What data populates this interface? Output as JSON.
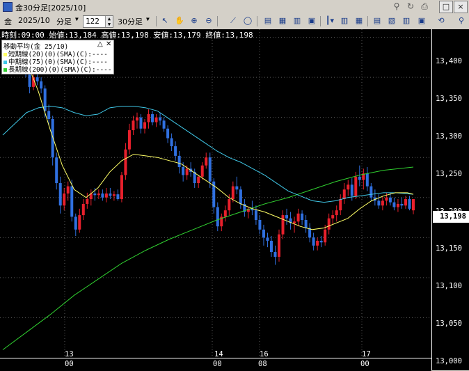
{
  "window": {
    "title": "金30分足[2025/10]",
    "buttons": [
      "□",
      "×"
    ]
  },
  "toolbar": {
    "symbol": "金",
    "contract": "2025/10",
    "bar_type": "分足",
    "count": "122",
    "interval": "30分足"
  },
  "info_bar": "時刻:09:00 始値:13,184 高値:13,198 安値:13,179 終値:13,198",
  "indicator_legend": {
    "title": "移動平均(金 25/10)",
    "lines": [
      {
        "label": "短期線(20)(0)(SMA)(C):----",
        "color": "#ffff66"
      },
      {
        "label": "中期線(75)(0)(SMA)(C):----",
        "color": "#40c8e8"
      },
      {
        "label": "長期線(200)(0)(SMA)(C):----",
        "color": "#30d030"
      }
    ]
  },
  "price_axis": {
    "labels": [
      "13,400",
      "13,350",
      "13,300",
      "13,250",
      "13,200",
      "13,150",
      "13,100",
      "13,050",
      "13,000"
    ],
    "current_price": "13,198"
  },
  "time_axis": {
    "day_labels": [
      "13",
      "14",
      "16",
      "17"
    ],
    "hour_labels": [
      "00",
      "00",
      "08",
      "00"
    ]
  },
  "chart_data": {
    "type": "candlestick",
    "ylim": [
      13000,
      13410
    ],
    "up_color": "#e8202c",
    "down_color": "#3070e0",
    "candles": [
      [
        13390,
        13395,
        13370,
        13382
      ],
      [
        13382,
        13392,
        13372,
        13388
      ],
      [
        13388,
        13398,
        13380,
        13385
      ],
      [
        13385,
        13390,
        13374,
        13378
      ],
      [
        13378,
        13386,
        13366,
        13382
      ],
      [
        13382,
        13384,
        13360,
        13366
      ],
      [
        13366,
        13372,
        13350,
        13356
      ],
      [
        13356,
        13360,
        13330,
        13338
      ],
      [
        13338,
        13356,
        13334,
        13350
      ],
      [
        13350,
        13356,
        13340,
        13345
      ],
      [
        13345,
        13350,
        13330,
        13336
      ],
      [
        13336,
        13340,
        13300,
        13308
      ],
      [
        13308,
        13316,
        13290,
        13298
      ],
      [
        13298,
        13302,
        13240,
        13250
      ],
      [
        13250,
        13256,
        13210,
        13218
      ],
      [
        13218,
        13226,
        13180,
        13190
      ],
      [
        13190,
        13212,
        13184,
        13205
      ],
      [
        13205,
        13220,
        13196,
        13214
      ],
      [
        13214,
        13222,
        13170,
        13176
      ],
      [
        13176,
        13180,
        13152,
        13160
      ],
      [
        13160,
        13186,
        13156,
        13178
      ],
      [
        13178,
        13198,
        13172,
        13192
      ],
      [
        13192,
        13206,
        13186,
        13198
      ],
      [
        13198,
        13210,
        13190,
        13205
      ],
      [
        13205,
        13212,
        13196,
        13203
      ],
      [
        13203,
        13210,
        13198,
        13205
      ],
      [
        13205,
        13210,
        13196,
        13200
      ],
      [
        13200,
        13212,
        13194,
        13205
      ],
      [
        13205,
        13212,
        13198,
        13202
      ],
      [
        13202,
        13208,
        13196,
        13204
      ],
      [
        13204,
        13210,
        13196,
        13198
      ],
      [
        13198,
        13232,
        13194,
        13228
      ],
      [
        13228,
        13268,
        13222,
        13260
      ],
      [
        13260,
        13292,
        13254,
        13284
      ],
      [
        13284,
        13302,
        13278,
        13296
      ],
      [
        13296,
        13306,
        13286,
        13300
      ],
      [
        13300,
        13304,
        13280,
        13286
      ],
      [
        13286,
        13298,
        13280,
        13294
      ],
      [
        13294,
        13310,
        13286,
        13304
      ],
      [
        13304,
        13308,
        13290,
        13294
      ],
      [
        13294,
        13304,
        13288,
        13300
      ],
      [
        13300,
        13306,
        13290,
        13296
      ],
      [
        13296,
        13300,
        13282,
        13286
      ],
      [
        13286,
        13290,
        13268,
        13274
      ],
      [
        13274,
        13280,
        13258,
        13264
      ],
      [
        13264,
        13270,
        13246,
        13252
      ],
      [
        13252,
        13258,
        13230,
        13238
      ],
      [
        13238,
        13244,
        13220,
        13228
      ],
      [
        13228,
        13240,
        13222,
        13236
      ],
      [
        13236,
        13244,
        13226,
        13232
      ],
      [
        13232,
        13236,
        13212,
        13218
      ],
      [
        13218,
        13228,
        13212,
        13226
      ],
      [
        13226,
        13244,
        13222,
        13240
      ],
      [
        13240,
        13256,
        13236,
        13250
      ],
      [
        13250,
        13256,
        13212,
        13220
      ],
      [
        13220,
        13224,
        13180,
        13188
      ],
      [
        13188,
        13194,
        13158,
        13164
      ],
      [
        13164,
        13180,
        13158,
        13176
      ],
      [
        13176,
        13190,
        13170,
        13184
      ],
      [
        13184,
        13204,
        13178,
        13198
      ],
      [
        13198,
        13220,
        13194,
        13214
      ],
      [
        13214,
        13226,
        13204,
        13210
      ],
      [
        13210,
        13214,
        13186,
        13192
      ],
      [
        13192,
        13198,
        13176,
        13182
      ],
      [
        13182,
        13188,
        13174,
        13186
      ],
      [
        13186,
        13196,
        13178,
        13184
      ],
      [
        13184,
        13190,
        13166,
        13172
      ],
      [
        13172,
        13178,
        13154,
        13160
      ],
      [
        13160,
        13166,
        13140,
        13150
      ],
      [
        13150,
        13156,
        13138,
        13146
      ],
      [
        13146,
        13152,
        13126,
        13132
      ],
      [
        13132,
        13140,
        13116,
        13126
      ],
      [
        13126,
        13160,
        13120,
        13154
      ],
      [
        13154,
        13184,
        13148,
        13178
      ],
      [
        13178,
        13186,
        13166,
        13174
      ],
      [
        13174,
        13182,
        13160,
        13168
      ],
      [
        13168,
        13176,
        13156,
        13170
      ],
      [
        13170,
        13186,
        13164,
        13180
      ],
      [
        13180,
        13184,
        13166,
        13172
      ],
      [
        13172,
        13178,
        13156,
        13162
      ],
      [
        13162,
        13168,
        13144,
        13150
      ],
      [
        13150,
        13156,
        13134,
        13140
      ],
      [
        13140,
        13150,
        13134,
        13146
      ],
      [
        13146,
        13152,
        13138,
        13144
      ],
      [
        13144,
        13166,
        13140,
        13160
      ],
      [
        13160,
        13180,
        13154,
        13174
      ],
      [
        13174,
        13184,
        13166,
        13178
      ],
      [
        13178,
        13190,
        13170,
        13184
      ],
      [
        13184,
        13204,
        13178,
        13198
      ],
      [
        13198,
        13218,
        13192,
        13210
      ],
      [
        13210,
        13222,
        13202,
        13216
      ],
      [
        13216,
        13224,
        13196,
        13202
      ],
      [
        13202,
        13232,
        13198,
        13226
      ],
      [
        13226,
        13240,
        13214,
        13222
      ],
      [
        13222,
        13236,
        13210,
        13230
      ],
      [
        13230,
        13238,
        13208,
        13214
      ],
      [
        13214,
        13218,
        13196,
        13200
      ],
      [
        13200,
        13210,
        13190,
        13196
      ],
      [
        13196,
        13204,
        13186,
        13190
      ],
      [
        13190,
        13202,
        13184,
        13196
      ],
      [
        13196,
        13206,
        13190,
        13200
      ],
      [
        13200,
        13206,
        13190,
        13194
      ],
      [
        13194,
        13200,
        13184,
        13188
      ],
      [
        13188,
        13198,
        13182,
        13192
      ],
      [
        13192,
        13200,
        13186,
        13190
      ],
      [
        13190,
        13202,
        13186,
        13198
      ],
      [
        13198,
        13202,
        13184,
        13186
      ],
      [
        13184,
        13198,
        13179,
        13198
      ]
    ],
    "sma20": [
      [
        0,
        13376
      ],
      [
        10,
        13382
      ],
      [
        20,
        13370
      ],
      [
        30,
        13332
      ],
      [
        40,
        13284
      ],
      [
        50,
        13240
      ],
      [
        60,
        13210
      ],
      [
        70,
        13200
      ],
      [
        80,
        13212
      ],
      [
        90,
        13232
      ],
      [
        100,
        13246
      ],
      [
        110,
        13254
      ],
      [
        120,
        13252
      ],
      [
        130,
        13250
      ],
      [
        140,
        13246
      ],
      [
        150,
        13242
      ],
      [
        160,
        13232
      ],
      [
        170,
        13222
      ],
      [
        180,
        13212
      ],
      [
        190,
        13200
      ],
      [
        200,
        13192
      ],
      [
        210,
        13186
      ],
      [
        220,
        13182
      ],
      [
        230,
        13176
      ],
      [
        240,
        13170
      ],
      [
        250,
        13164
      ],
      [
        260,
        13160
      ],
      [
        270,
        13162
      ],
      [
        280,
        13168
      ],
      [
        290,
        13174
      ],
      [
        300,
        13186
      ],
      [
        310,
        13196
      ],
      [
        320,
        13202
      ],
      [
        330,
        13206
      ],
      [
        340,
        13206
      ],
      [
        345,
        13204
      ]
    ],
    "sma75": [
      [
        0,
        13278
      ],
      [
        10,
        13292
      ],
      [
        20,
        13306
      ],
      [
        30,
        13312
      ],
      [
        40,
        13314
      ],
      [
        50,
        13312
      ],
      [
        60,
        13306
      ],
      [
        70,
        13302
      ],
      [
        80,
        13304
      ],
      [
        90,
        13312
      ],
      [
        100,
        13314
      ],
      [
        110,
        13314
      ],
      [
        120,
        13312
      ],
      [
        130,
        13308
      ],
      [
        140,
        13298
      ],
      [
        150,
        13288
      ],
      [
        160,
        13278
      ],
      [
        170,
        13268
      ],
      [
        180,
        13258
      ],
      [
        190,
        13250
      ],
      [
        200,
        13244
      ],
      [
        210,
        13236
      ],
      [
        220,
        13228
      ],
      [
        230,
        13218
      ],
      [
        240,
        13208
      ],
      [
        250,
        13202
      ],
      [
        260,
        13196
      ],
      [
        270,
        13194
      ],
      [
        280,
        13196
      ],
      [
        290,
        13200
      ],
      [
        300,
        13202
      ],
      [
        310,
        13204
      ],
      [
        320,
        13206
      ],
      [
        330,
        13206
      ],
      [
        345,
        13204
      ]
    ],
    "sma200": [
      [
        0,
        13010
      ],
      [
        20,
        13032
      ],
      [
        40,
        13054
      ],
      [
        60,
        13078
      ],
      [
        80,
        13098
      ],
      [
        100,
        13118
      ],
      [
        120,
        13134
      ],
      [
        140,
        13148
      ],
      [
        160,
        13160
      ],
      [
        180,
        13172
      ],
      [
        200,
        13182
      ],
      [
        220,
        13192
      ],
      [
        240,
        13200
      ],
      [
        260,
        13210
      ],
      [
        280,
        13220
      ],
      [
        300,
        13228
      ],
      [
        320,
        13234
      ],
      [
        345,
        13238
      ]
    ]
  }
}
